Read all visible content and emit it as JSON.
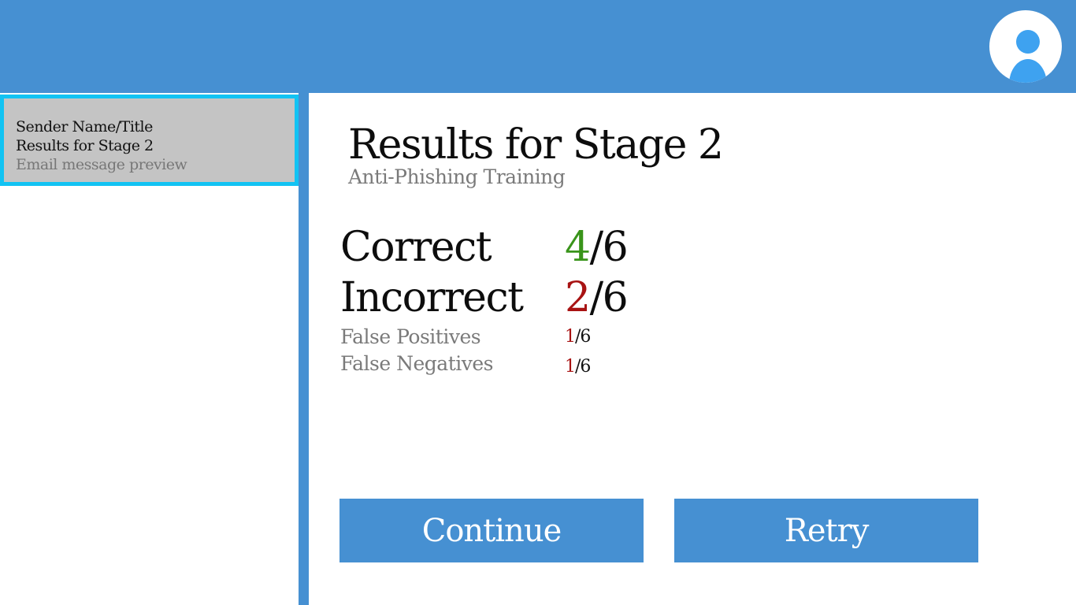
{
  "header": {
    "avatar_icon": "user-avatar-icon",
    "colors": {
      "bar": "#4690d2",
      "avatar_bg": "#ffffff",
      "avatar_figure": "#3ea2f0"
    }
  },
  "sidebar": {
    "emails": [
      {
        "sender": "Sender Name/Title",
        "subject": "Results for Stage 2",
        "preview": "Email message preview",
        "selected": true
      }
    ],
    "colors": {
      "item_bg": "#c4c4c4",
      "selected_border": "#12c3f3"
    }
  },
  "results": {
    "title": "Results for Stage 2",
    "subtitle": "Anti-Phishing Training",
    "correct": {
      "label": "Correct",
      "value": "4",
      "total": "/6"
    },
    "incorrect": {
      "label": "Incorrect",
      "value": "2",
      "total": "/6"
    },
    "false_positives": {
      "label": "False Positives",
      "value": "1",
      "total": "/6"
    },
    "false_negatives": {
      "label": "False Negatives",
      "value": "1",
      "total": "/6"
    },
    "colors": {
      "correct": "#39941a",
      "incorrect": "#a81313"
    }
  },
  "actions": {
    "continue_label": "Continue",
    "retry_label": "Retry",
    "button_color": "#4690d2"
  }
}
